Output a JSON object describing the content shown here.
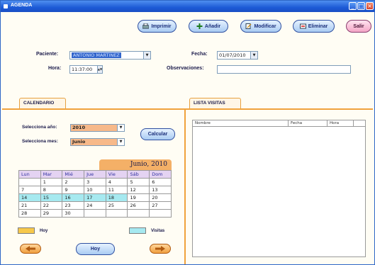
{
  "window": {
    "title": "AGENDA",
    "minimize": "_",
    "maximize": "□",
    "close": "×"
  },
  "toolbar": {
    "imprimir": "Imprimir",
    "anadir": "Añadir",
    "modificar": "Modificar",
    "eliminar": "Eliminar",
    "salir": "Salir"
  },
  "form": {
    "paciente_label": "Paciente:",
    "paciente_value": "ANTONIO MARTINEZ",
    "fecha_label": "Fecha:",
    "fecha_value": "01/07/2010",
    "hora_label": "Hora:",
    "hora_value": "11:37:00",
    "observaciones_label": "Observaciones:",
    "observaciones_value": ""
  },
  "tabs": {
    "calendario": "CALENDARIO",
    "lista_visitas": "LISTA VISITAS"
  },
  "calendar_controls": {
    "anio_label": "Selecciona año:",
    "anio_value": "2010",
    "mes_label": "Selecciona mes:",
    "mes_value": "Junio",
    "calcular": "Calcular"
  },
  "calendar": {
    "month_title": "Junio, 2010",
    "weekdays": [
      "Lun",
      "Mar",
      "Mié",
      "Jue",
      "Vie",
      "Sáb",
      "Dom"
    ],
    "weeks": [
      [
        "",
        "1",
        "2",
        "3",
        "4",
        "5",
        "6"
      ],
      [
        "7",
        "8",
        "9",
        "10",
        "11",
        "12",
        "13"
      ],
      [
        "14",
        "15",
        "16",
        "17",
        "18",
        "19",
        "20"
      ],
      [
        "21",
        "22",
        "23",
        "24",
        "25",
        "26",
        "27"
      ],
      [
        "28",
        "29",
        "30",
        "",
        "",
        "",
        ""
      ]
    ],
    "visit_days": [
      "14",
      "15",
      "16",
      "17",
      "18"
    ]
  },
  "legend": {
    "hoy": "Hoy",
    "visitas": "Visitas",
    "hoy_color": "#f7c84a",
    "visitas_color": "#a6e9f0"
  },
  "nav": {
    "hoy": "Hoy"
  },
  "lista": {
    "columns": [
      "Nombre",
      "Fecha",
      "Hora"
    ]
  },
  "colors": {
    "accent_orange": "#f0a23c",
    "title_blue": "#1c5ad6",
    "visit_cyan": "#a6e9f0"
  }
}
